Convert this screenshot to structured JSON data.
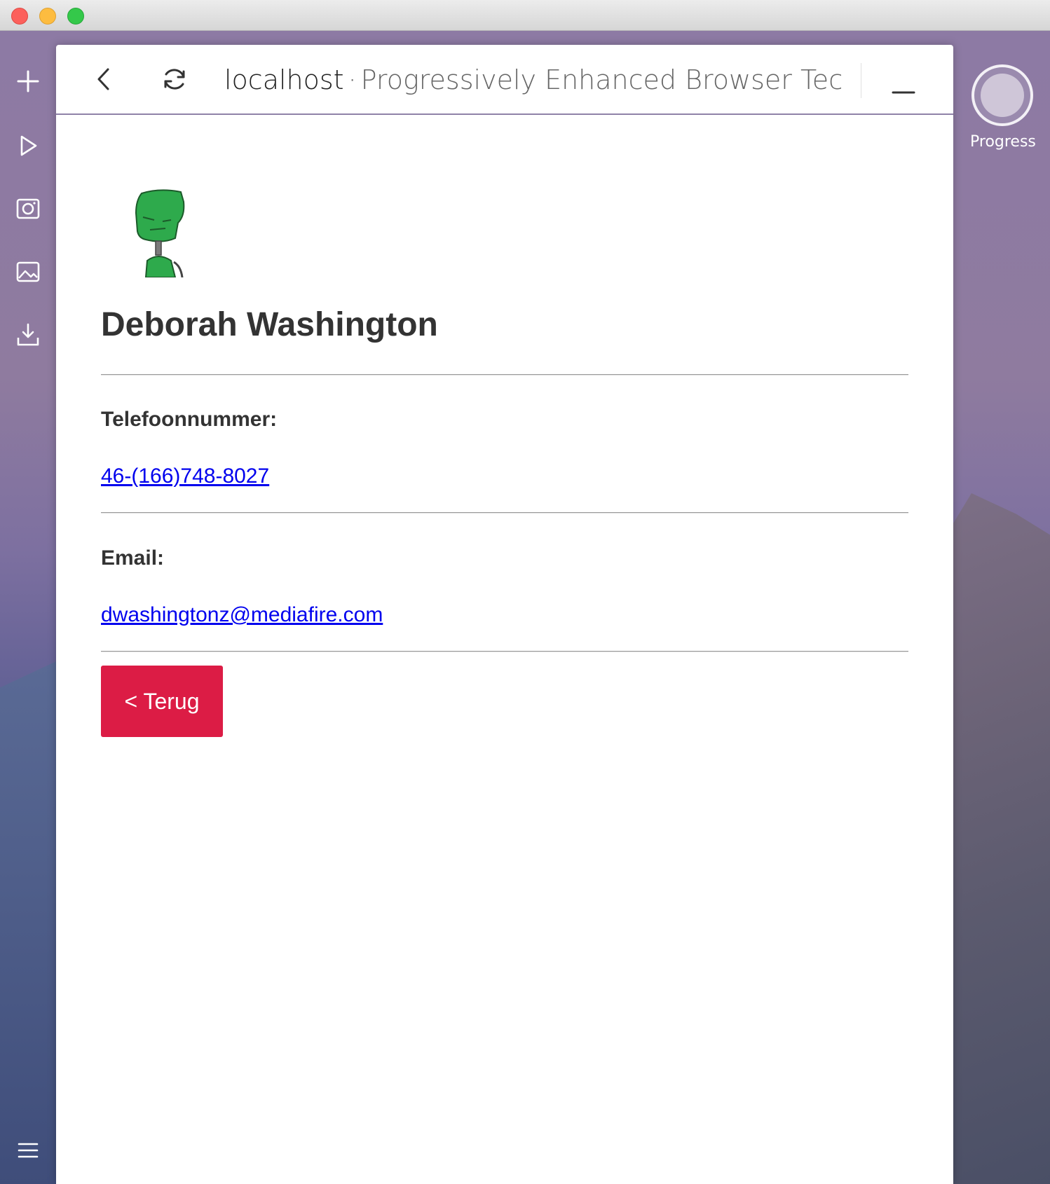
{
  "window": {
    "traffic_lights": [
      "close",
      "minimize",
      "zoom"
    ]
  },
  "sidebar": {
    "items": [
      {
        "icon": "plus-icon"
      },
      {
        "icon": "play-icon"
      },
      {
        "icon": "camera-icon"
      },
      {
        "icon": "image-icon"
      },
      {
        "icon": "download-icon"
      },
      {
        "icon": "menu-icon"
      }
    ]
  },
  "progress_widget": {
    "label": "Progress"
  },
  "browser": {
    "host": "localhost",
    "separator": "·",
    "page_title": "Progressively Enhanced Browser Tech"
  },
  "profile": {
    "name": "Deborah Washington",
    "phone_label": "Telefoonnummer:",
    "phone_value": "46-(166)748-8027",
    "email_label": "Email:",
    "email_value": "dwashingtonz@mediafire.com",
    "back_button": "< Terug"
  },
  "colors": {
    "back_button": "#dc1c45",
    "link": "#0000ee",
    "text": "#333333"
  }
}
